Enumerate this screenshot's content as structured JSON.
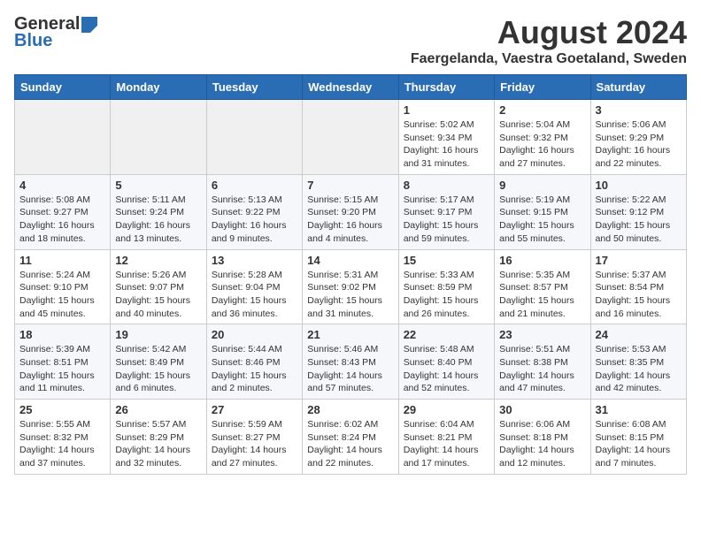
{
  "logo": {
    "general": "General",
    "blue": "Blue"
  },
  "title": {
    "month_year": "August 2024",
    "location": "Faergelanda, Vaestra Goetaland, Sweden"
  },
  "headers": [
    "Sunday",
    "Monday",
    "Tuesday",
    "Wednesday",
    "Thursday",
    "Friday",
    "Saturday"
  ],
  "weeks": [
    [
      {
        "day": "",
        "sunrise": "",
        "sunset": "",
        "daylight": ""
      },
      {
        "day": "",
        "sunrise": "",
        "sunset": "",
        "daylight": ""
      },
      {
        "day": "",
        "sunrise": "",
        "sunset": "",
        "daylight": ""
      },
      {
        "day": "",
        "sunrise": "",
        "sunset": "",
        "daylight": ""
      },
      {
        "day": "1",
        "sunrise": "Sunrise: 5:02 AM",
        "sunset": "Sunset: 9:34 PM",
        "daylight": "Daylight: 16 hours and 31 minutes."
      },
      {
        "day": "2",
        "sunrise": "Sunrise: 5:04 AM",
        "sunset": "Sunset: 9:32 PM",
        "daylight": "Daylight: 16 hours and 27 minutes."
      },
      {
        "day": "3",
        "sunrise": "Sunrise: 5:06 AM",
        "sunset": "Sunset: 9:29 PM",
        "daylight": "Daylight: 16 hours and 22 minutes."
      }
    ],
    [
      {
        "day": "4",
        "sunrise": "Sunrise: 5:08 AM",
        "sunset": "Sunset: 9:27 PM",
        "daylight": "Daylight: 16 hours and 18 minutes."
      },
      {
        "day": "5",
        "sunrise": "Sunrise: 5:11 AM",
        "sunset": "Sunset: 9:24 PM",
        "daylight": "Daylight: 16 hours and 13 minutes."
      },
      {
        "day": "6",
        "sunrise": "Sunrise: 5:13 AM",
        "sunset": "Sunset: 9:22 PM",
        "daylight": "Daylight: 16 hours and 9 minutes."
      },
      {
        "day": "7",
        "sunrise": "Sunrise: 5:15 AM",
        "sunset": "Sunset: 9:20 PM",
        "daylight": "Daylight: 16 hours and 4 minutes."
      },
      {
        "day": "8",
        "sunrise": "Sunrise: 5:17 AM",
        "sunset": "Sunset: 9:17 PM",
        "daylight": "Daylight: 15 hours and 59 minutes."
      },
      {
        "day": "9",
        "sunrise": "Sunrise: 5:19 AM",
        "sunset": "Sunset: 9:15 PM",
        "daylight": "Daylight: 15 hours and 55 minutes."
      },
      {
        "day": "10",
        "sunrise": "Sunrise: 5:22 AM",
        "sunset": "Sunset: 9:12 PM",
        "daylight": "Daylight: 15 hours and 50 minutes."
      }
    ],
    [
      {
        "day": "11",
        "sunrise": "Sunrise: 5:24 AM",
        "sunset": "Sunset: 9:10 PM",
        "daylight": "Daylight: 15 hours and 45 minutes."
      },
      {
        "day": "12",
        "sunrise": "Sunrise: 5:26 AM",
        "sunset": "Sunset: 9:07 PM",
        "daylight": "Daylight: 15 hours and 40 minutes."
      },
      {
        "day": "13",
        "sunrise": "Sunrise: 5:28 AM",
        "sunset": "Sunset: 9:04 PM",
        "daylight": "Daylight: 15 hours and 36 minutes."
      },
      {
        "day": "14",
        "sunrise": "Sunrise: 5:31 AM",
        "sunset": "Sunset: 9:02 PM",
        "daylight": "Daylight: 15 hours and 31 minutes."
      },
      {
        "day": "15",
        "sunrise": "Sunrise: 5:33 AM",
        "sunset": "Sunset: 8:59 PM",
        "daylight": "Daylight: 15 hours and 26 minutes."
      },
      {
        "day": "16",
        "sunrise": "Sunrise: 5:35 AM",
        "sunset": "Sunset: 8:57 PM",
        "daylight": "Daylight: 15 hours and 21 minutes."
      },
      {
        "day": "17",
        "sunrise": "Sunrise: 5:37 AM",
        "sunset": "Sunset: 8:54 PM",
        "daylight": "Daylight: 15 hours and 16 minutes."
      }
    ],
    [
      {
        "day": "18",
        "sunrise": "Sunrise: 5:39 AM",
        "sunset": "Sunset: 8:51 PM",
        "daylight": "Daylight: 15 hours and 11 minutes."
      },
      {
        "day": "19",
        "sunrise": "Sunrise: 5:42 AM",
        "sunset": "Sunset: 8:49 PM",
        "daylight": "Daylight: 15 hours and 6 minutes."
      },
      {
        "day": "20",
        "sunrise": "Sunrise: 5:44 AM",
        "sunset": "Sunset: 8:46 PM",
        "daylight": "Daylight: 15 hours and 2 minutes."
      },
      {
        "day": "21",
        "sunrise": "Sunrise: 5:46 AM",
        "sunset": "Sunset: 8:43 PM",
        "daylight": "Daylight: 14 hours and 57 minutes."
      },
      {
        "day": "22",
        "sunrise": "Sunrise: 5:48 AM",
        "sunset": "Sunset: 8:40 PM",
        "daylight": "Daylight: 14 hours and 52 minutes."
      },
      {
        "day": "23",
        "sunrise": "Sunrise: 5:51 AM",
        "sunset": "Sunset: 8:38 PM",
        "daylight": "Daylight: 14 hours and 47 minutes."
      },
      {
        "day": "24",
        "sunrise": "Sunrise: 5:53 AM",
        "sunset": "Sunset: 8:35 PM",
        "daylight": "Daylight: 14 hours and 42 minutes."
      }
    ],
    [
      {
        "day": "25",
        "sunrise": "Sunrise: 5:55 AM",
        "sunset": "Sunset: 8:32 PM",
        "daylight": "Daylight: 14 hours and 37 minutes."
      },
      {
        "day": "26",
        "sunrise": "Sunrise: 5:57 AM",
        "sunset": "Sunset: 8:29 PM",
        "daylight": "Daylight: 14 hours and 32 minutes."
      },
      {
        "day": "27",
        "sunrise": "Sunrise: 5:59 AM",
        "sunset": "Sunset: 8:27 PM",
        "daylight": "Daylight: 14 hours and 27 minutes."
      },
      {
        "day": "28",
        "sunrise": "Sunrise: 6:02 AM",
        "sunset": "Sunset: 8:24 PM",
        "daylight": "Daylight: 14 hours and 22 minutes."
      },
      {
        "day": "29",
        "sunrise": "Sunrise: 6:04 AM",
        "sunset": "Sunset: 8:21 PM",
        "daylight": "Daylight: 14 hours and 17 minutes."
      },
      {
        "day": "30",
        "sunrise": "Sunrise: 6:06 AM",
        "sunset": "Sunset: 8:18 PM",
        "daylight": "Daylight: 14 hours and 12 minutes."
      },
      {
        "day": "31",
        "sunrise": "Sunrise: 6:08 AM",
        "sunset": "Sunset: 8:15 PM",
        "daylight": "Daylight: 14 hours and 7 minutes."
      }
    ]
  ]
}
